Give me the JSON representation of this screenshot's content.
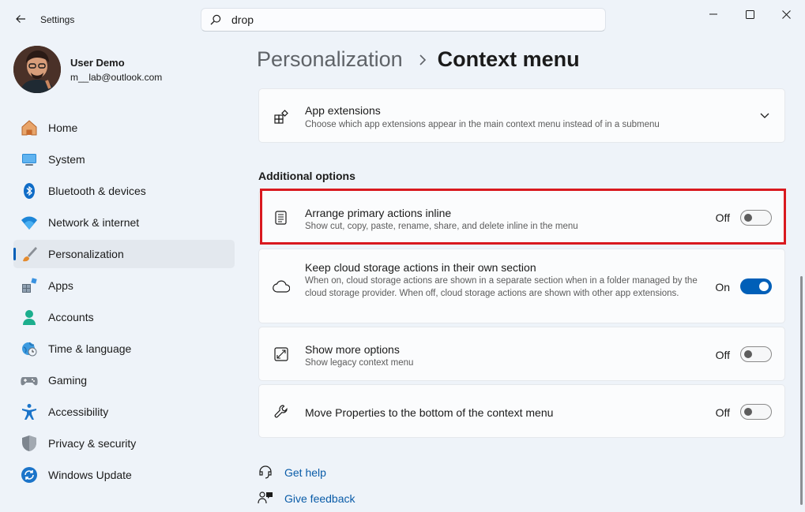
{
  "window": {
    "title": "Settings",
    "search_value": "drop"
  },
  "profile": {
    "name": "User Demo",
    "email": "m__lab@outlook.com"
  },
  "nav": [
    {
      "label": "Home",
      "icon": "home-icon"
    },
    {
      "label": "System",
      "icon": "system-icon"
    },
    {
      "label": "Bluetooth & devices",
      "icon": "bluetooth-icon"
    },
    {
      "label": "Network & internet",
      "icon": "wifi-icon"
    },
    {
      "label": "Personalization",
      "icon": "brush-icon",
      "active": true
    },
    {
      "label": "Apps",
      "icon": "apps-icon"
    },
    {
      "label": "Accounts",
      "icon": "person-icon"
    },
    {
      "label": "Time & language",
      "icon": "globe-clock-icon"
    },
    {
      "label": "Gaming",
      "icon": "gamepad-icon"
    },
    {
      "label": "Accessibility",
      "icon": "accessibility-icon"
    },
    {
      "label": "Privacy & security",
      "icon": "shield-icon"
    },
    {
      "label": "Windows Update",
      "icon": "update-icon"
    }
  ],
  "breadcrumb": {
    "parent": "Personalization",
    "current": "Context menu"
  },
  "app_extensions": {
    "title": "App extensions",
    "description": "Choose which app extensions appear in the main context menu instead of in a submenu"
  },
  "additional_options": {
    "title": "Additional options",
    "items": [
      {
        "title": "Arrange primary actions inline",
        "description": "Show cut, copy, paste, rename, share, and delete inline in the menu",
        "state": "Off"
      },
      {
        "title": "Keep cloud storage actions in their own section",
        "description": "When on, cloud storage actions are shown in a separate section when in a folder managed by the cloud storage provider. When off, cloud storage actions are shown with other app extensions.",
        "state": "On"
      },
      {
        "title": "Show more options",
        "description": "Show legacy context menu",
        "state": "Off"
      },
      {
        "title": "Move Properties to the bottom of the context menu",
        "description": "",
        "state": "Off"
      }
    ]
  },
  "links": {
    "help": "Get help",
    "feedback": "Give feedback"
  },
  "colors": {
    "accent": "#005fb8",
    "highlight": "#d9191f",
    "background": "#eef3f9"
  }
}
